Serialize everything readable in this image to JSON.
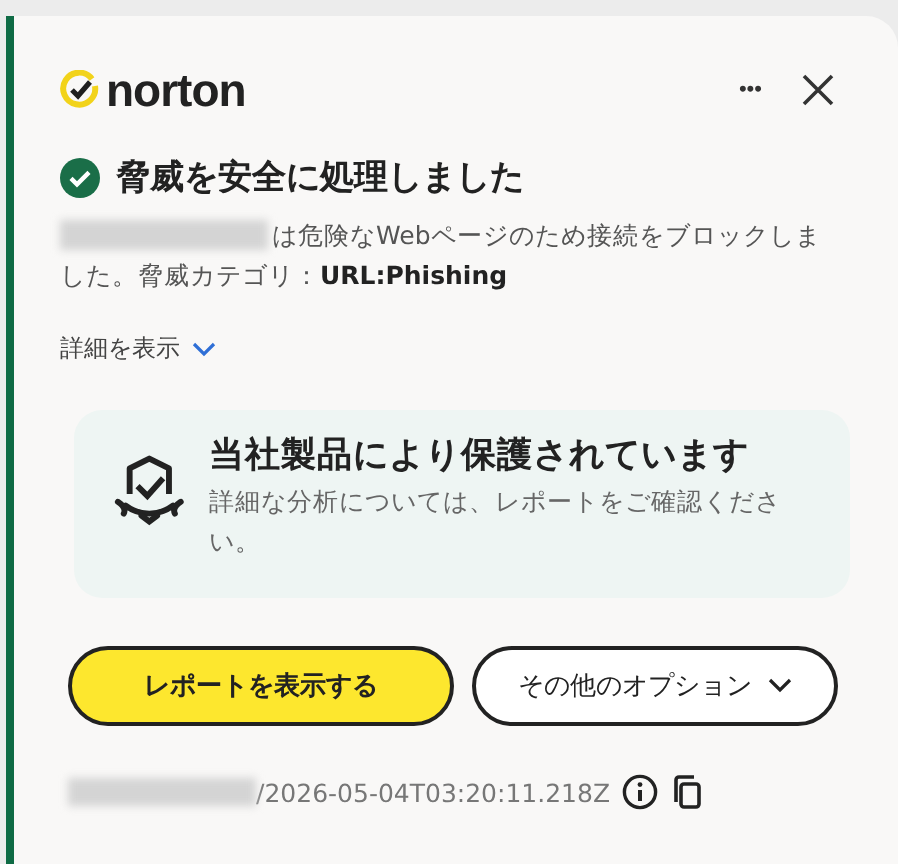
{
  "header": {
    "logo": "norton",
    "menu": "•••"
  },
  "status": {
    "title": "脅威を安全に処理しました",
    "message": "は危険なWebページのため接続をブロックしました。脅威カテゴリ：**URL:Phishing**"
  },
  "details_link": {
    "label": "詳細を表示",
    "expanded": false
  },
  "protection": {
    "title": "当社製品により保護されています",
    "text": "詳細な分析については、レポートをご確認ください。"
  },
  "buttons": [
    {
      "label": "レポートを表示する",
      "kind": "primary"
    },
    {
      "label": "その他のオプション",
      "kind": "dropdown"
    }
  ],
  "footer": {
    "reference": "/2026-05-04T03:20:11.218Z"
  }
}
